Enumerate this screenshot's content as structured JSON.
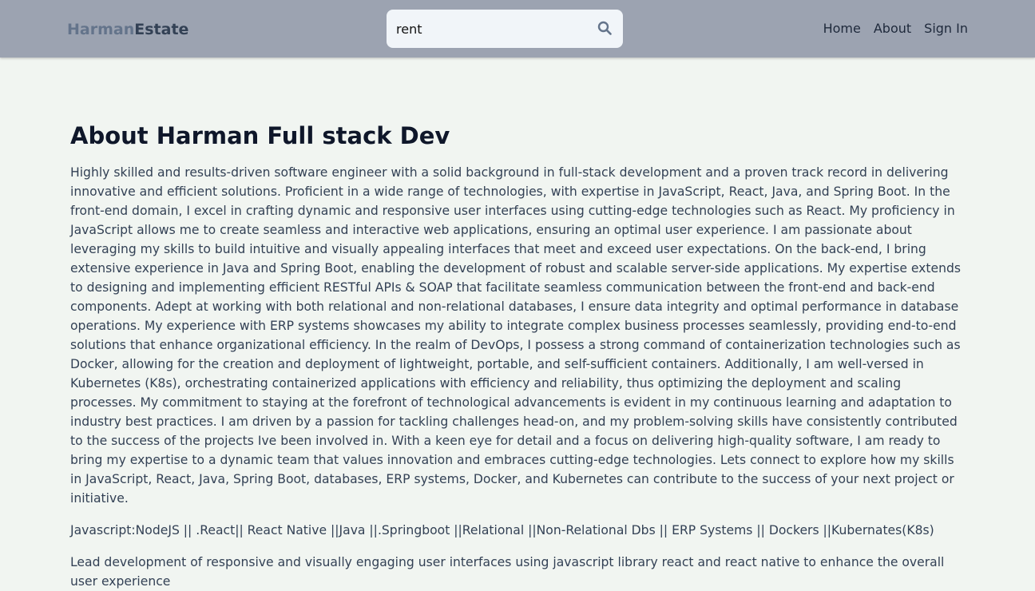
{
  "header": {
    "logo_part1": "Harman",
    "logo_part2": "Estate",
    "search": {
      "value": "rent",
      "icon": "search-icon"
    },
    "nav": {
      "home": "Home",
      "about": "About",
      "sign_in": "Sign In"
    }
  },
  "main": {
    "title": "About Harman Full stack Dev",
    "bio": "Highly skilled and results-driven software engineer with a solid background in full-stack development and a proven track record in delivering innovative and efficient solutions. Proficient in a wide range of technologies, with expertise in JavaScript, React, Java, and Spring Boot. In the front-end domain, I excel in crafting dynamic and responsive user interfaces using cutting-edge technologies such as React. My proficiency in JavaScript allows me to create seamless and interactive web applications, ensuring an optimal user experience. I am passionate about leveraging my skills to build intuitive and visually appealing interfaces that meet and exceed user expectations. On the back-end, I bring extensive experience in Java and Spring Boot, enabling the development of robust and scalable server-side applications. My expertise extends to designing and implementing efficient RESTful APIs & SOAP that facilitate seamless communication between the front-end and back-end components. Adept at working with both relational and non-relational databases, I ensure data integrity and optimal performance in database operations. My experience with ERP systems showcases my ability to integrate complex business processes seamlessly, providing end-to-end solutions that enhance organizational efficiency. In the realm of DevOps, I possess a strong command of containerization technologies such as Docker, allowing for the creation and deployment of lightweight, portable, and self-sufficient containers. Additionally, I am well-versed in Kubernetes (K8s), orchestrating containerized applications with efficiency and reliability, thus optimizing the deployment and scaling processes. My commitment to staying at the forefront of technological advancements is evident in my continuous learning and adaptation to industry best practices. I am driven by a passion for tackling challenges head-on, and my problem-solving skills have consistently contributed to the success of the projects Ive been involved in. With a keen eye for detail and a focus on delivering high-quality software, I am ready to bring my expertise to a dynamic team that values innovation and embraces cutting-edge technologies. Lets connect to explore how my skills in JavaScript, React, Java, Spring Boot, databases, ERP systems, Docker, and Kubernetes can contribute to the success of your next project or initiative.",
    "skills": "Javascript:NodeJS || .React|| React Native ||Java ||.Springboot ||Relational ||Non-Relational Dbs || ERP Systems || Dockers ||Kubernates(K8s)",
    "lead_partial": "Lead development of responsive and visually engaging user interfaces using javascript library react and react native to enhance the overall user experience"
  }
}
